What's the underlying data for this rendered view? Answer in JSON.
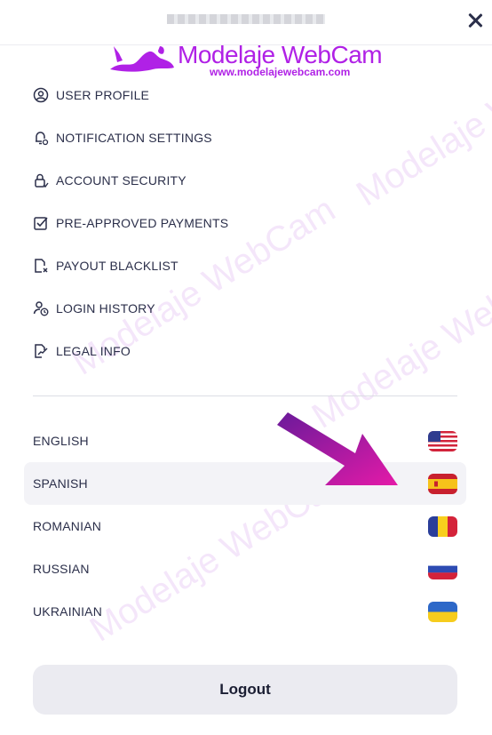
{
  "header": {
    "close_icon": "close-icon"
  },
  "logo": {
    "brand": "Modelaje WebCam",
    "url": "www.modelajewebcam.com"
  },
  "menu": [
    {
      "label": "USER PROFILE",
      "icon": "user-profile-icon"
    },
    {
      "label": "NOTIFICATION SETTINGS",
      "icon": "bell-settings-icon"
    },
    {
      "label": "ACCOUNT SECURITY",
      "icon": "lock-icon"
    },
    {
      "label": "PRE-APPROVED PAYMENTS",
      "icon": "checklist-icon"
    },
    {
      "label": "PAYOUT BLACKLIST",
      "icon": "document-x-icon"
    },
    {
      "label": "LOGIN HISTORY",
      "icon": "user-clock-icon"
    },
    {
      "label": "LEGAL INFO",
      "icon": "document-edit-icon"
    }
  ],
  "languages": [
    {
      "label": "ENGLISH",
      "flag": "us-flag-icon",
      "active": false
    },
    {
      "label": "SPANISH",
      "flag": "es-flag-icon",
      "active": true
    },
    {
      "label": "ROMANIAN",
      "flag": "ro-flag-icon",
      "active": false
    },
    {
      "label": "RUSSIAN",
      "flag": "ru-flag-icon",
      "active": false
    },
    {
      "label": "UKRAINIAN",
      "flag": "ua-flag-icon",
      "active": false
    }
  ],
  "logout_label": "Logout",
  "watermark": "Modelaje WebCam",
  "colors": {
    "accent": "#b021e6",
    "text": "#2b2f4a",
    "active_bg": "#f3f3f7",
    "button_bg": "#ebebf1"
  }
}
